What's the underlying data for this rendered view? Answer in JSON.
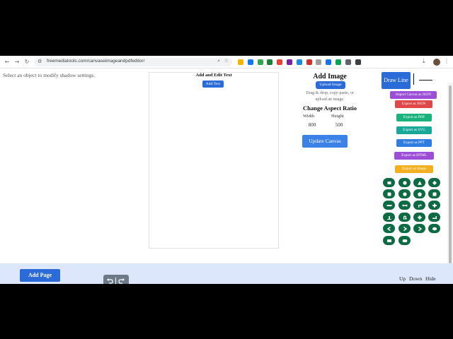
{
  "browser": {
    "url": "freemediatools.com/canvaseimageandpdfeditor/",
    "extension_colors": [
      "#f4b400",
      "#1a73e8",
      "#34a853",
      "#188038",
      "#ea4335",
      "#7b1fa2",
      "#1e88e5",
      "#d32f2f",
      "#9e9e9e",
      "#1a73e8",
      "#0f9d58",
      "#5f6368",
      "#3c4043"
    ]
  },
  "page": {
    "shadow_message": "Select an object to modify shadow settings.",
    "text_panel": {
      "title": "Add and Edit Text",
      "add_text_label": "Add Text"
    },
    "image_panel": {
      "title": "Add Image",
      "upload_label": "Upload Image",
      "drag_hint": "Drag & drop, copy-paste, or upload an image.",
      "aspect_title": "Change Aspect Ratio",
      "width_label": "Width",
      "height_label": "Height",
      "width_value": "800",
      "height_value": "500",
      "update_label": "Update Canvas"
    },
    "draw_line_label": "Draw Line",
    "exports": [
      {
        "label": "Import Canvas as JSON",
        "color": "#9b4fd6"
      },
      {
        "label": "Export as JSON",
        "color": "#e04848"
      },
      {
        "label": "Export as PDF",
        "color": "#1bb37d"
      },
      {
        "label": "Export as SVG",
        "color": "#17a89a"
      },
      {
        "label": "Export as PPT",
        "color": "#2f7de1"
      },
      {
        "label": "Export as HTML",
        "color": "#9b4fd6"
      },
      {
        "label": "Export as Image",
        "color": "#f2b01e"
      }
    ],
    "shapes": [
      "rectangle-icon",
      "circle-icon",
      "triangle-icon",
      "diamond-icon",
      "rounded-square-icon",
      "circle-outline-icon",
      "pentagon-icon",
      "square-icon",
      "bar-icon",
      "double-arrow-icon",
      "corner-arrow-icon",
      "cross-icon",
      "baseline-icon",
      "u-turn-icon",
      "four-way-arrow-icon",
      "corner-icon",
      "left-arrow-icon",
      "right-arrow-icon",
      "right-arrow-icon",
      "oval-icon",
      "wide-rectangle-icon",
      "rounded-rectangle-icon"
    ],
    "shape_color": "#0d6b43",
    "bottom": {
      "add_page_label": "Add Page",
      "up_label": "Up",
      "down_label": "Down",
      "hide_label": "Hide"
    }
  }
}
